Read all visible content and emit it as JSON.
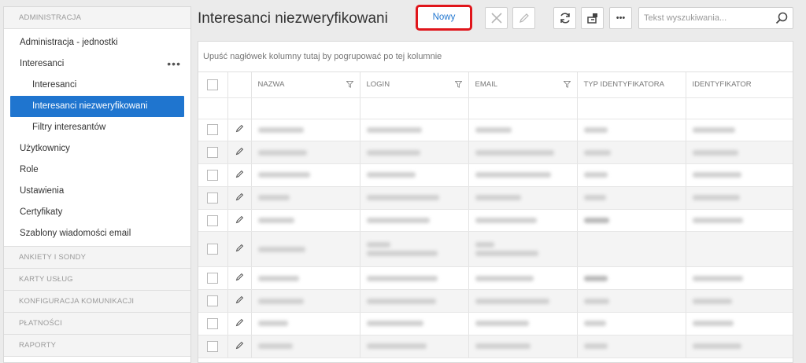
{
  "sidebar": {
    "administracja": "ADMINISTRACJA",
    "items": [
      {
        "label": "Administracja - jednostki"
      },
      {
        "label": "Interesanci",
        "menu": "•••"
      },
      {
        "label": "Interesanci"
      },
      {
        "label": "Interesanci niezweryfikowani"
      },
      {
        "label": "Filtry interesantów"
      },
      {
        "label": "Użytkownicy"
      },
      {
        "label": "Role"
      },
      {
        "label": "Ustawienia"
      },
      {
        "label": "Certyfikaty"
      },
      {
        "label": "Szablony wiadomości email"
      }
    ],
    "sections": [
      "ANKIETY I SONDY",
      "KARTY USŁUG",
      "KONFIGURACJA KOMUNIKACJI",
      "PŁATNOŚCI",
      "RAPORTY"
    ]
  },
  "header": {
    "title": "Interesanci niezweryfikowani",
    "new_label": "Nowy",
    "search_placeholder": "Tekst wyszukiwania..."
  },
  "toolbar": {
    "more_label": "•••"
  },
  "grid": {
    "group_hint": "Upuść nagłówek kolumny tutaj by pogrupować po tej kolumnie",
    "columns": [
      "NAZWA",
      "LOGIN",
      "EMAIL",
      "TYP IDENTYFIKATORA",
      "IDENTYFIKATOR"
    ],
    "row_count": 10
  },
  "colors": {
    "accent": "#1f75cf",
    "highlight_border": "#e0151b"
  }
}
